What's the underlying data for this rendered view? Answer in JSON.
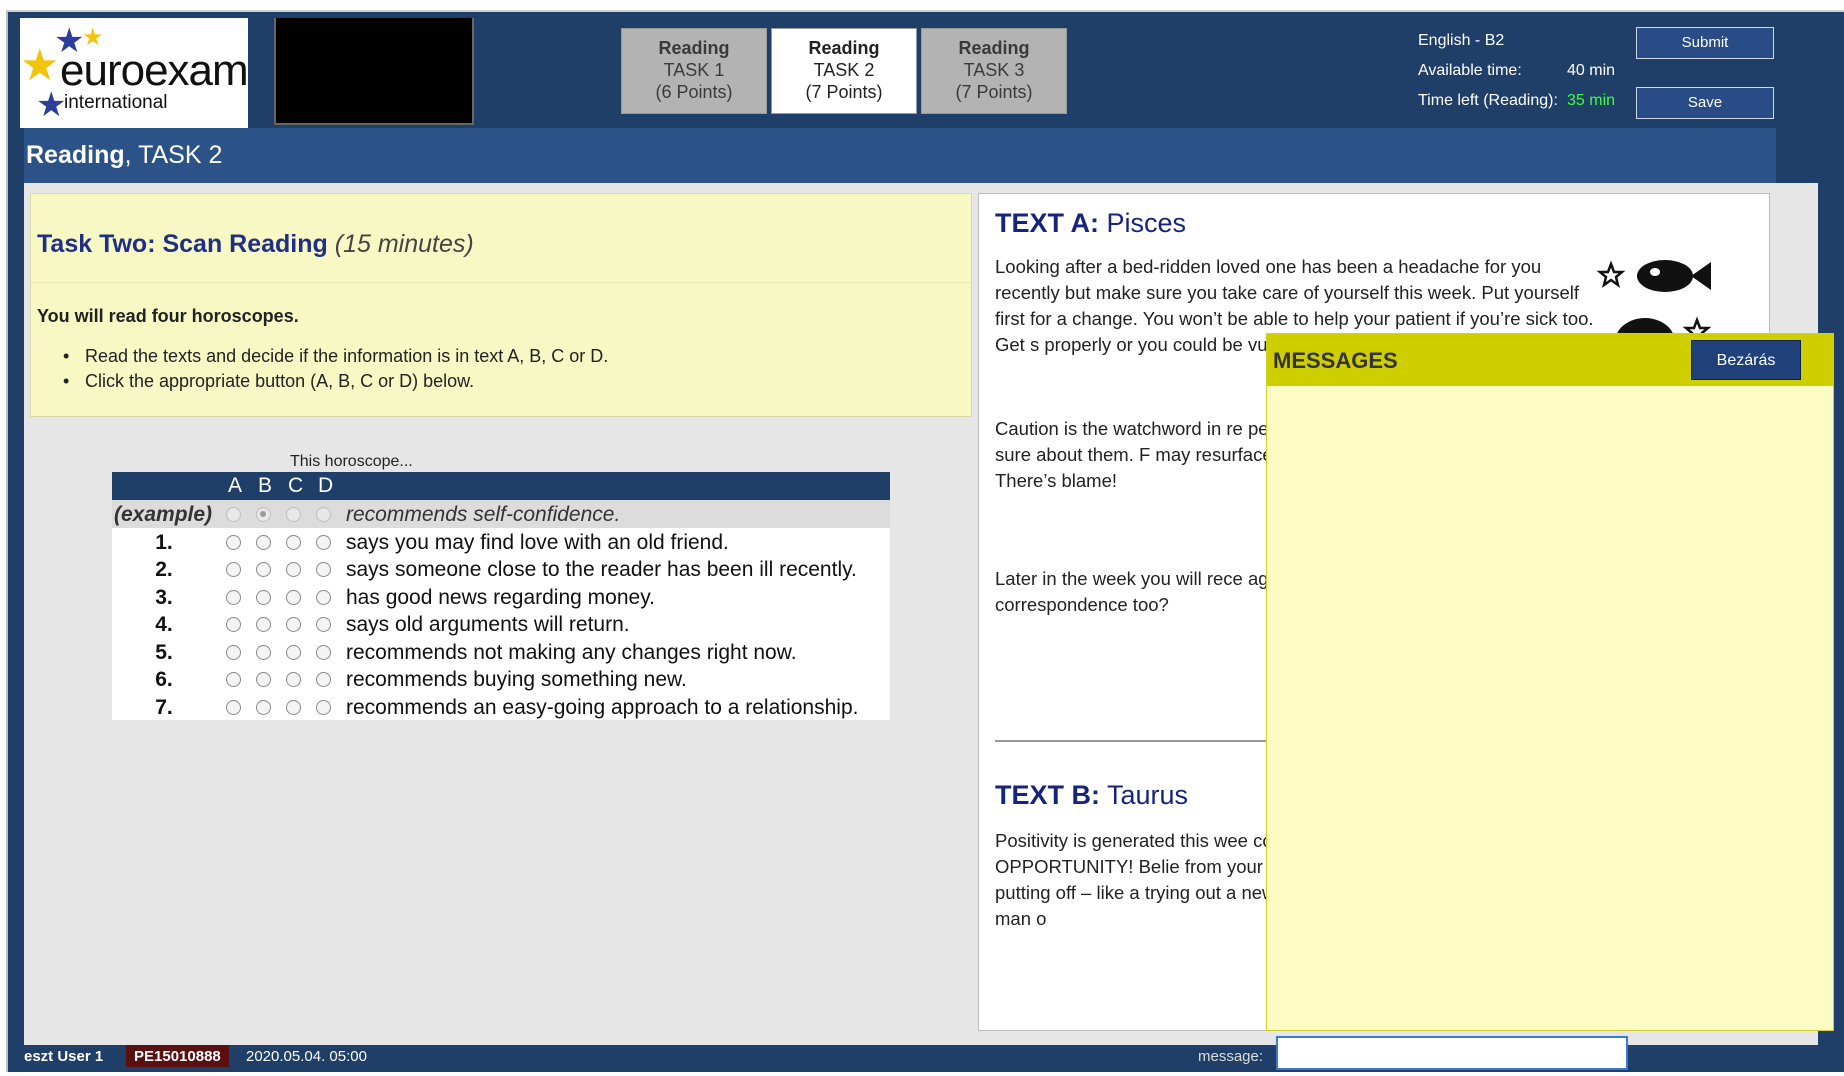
{
  "header": {
    "logo": {
      "name": "euroexam",
      "sub": "international"
    },
    "tabs": [
      {
        "line1": "Reading",
        "line2": "TASK 1",
        "line3": "(6 Points)",
        "active": false
      },
      {
        "line1": "Reading",
        "line2": "TASK 2",
        "line3": "(7 Points)",
        "active": true
      },
      {
        "line1": "Reading",
        "line2": "TASK 3",
        "line3": "(7 Points)",
        "active": false
      }
    ],
    "level": "English - B2",
    "available_label": "Available time:",
    "available_value": "40 min",
    "time_left_label": "Time left (Reading):",
    "time_left_value": "35 min",
    "submit_label": "Submit",
    "save_label": "Save"
  },
  "titlebar": {
    "bold": "Reading",
    "rest": ", TASK 2"
  },
  "task": {
    "title": "Task Two: Scan Reading",
    "duration": "(15 minutes)",
    "intro": "You will read four horoscopes.",
    "bullets": [
      "Read the texts and decide if the information is in text A, B, C or D.",
      "Click the appropriate button (A, B, C or D) below."
    ]
  },
  "questions": {
    "caption": "This horoscope...",
    "columns": [
      "A",
      "B",
      "C",
      "D"
    ],
    "example": {
      "num": "(example)",
      "text": "recommends self-confidence.",
      "selected": 1
    },
    "rows": [
      {
        "num": "1.",
        "text": "says you may find love with an old friend."
      },
      {
        "num": "2.",
        "text": "says someone close to the reader has been ill recently."
      },
      {
        "num": "3.",
        "text": "has good news regarding money."
      },
      {
        "num": "4.",
        "text": "says old arguments will return."
      },
      {
        "num": "5.",
        "text": "recommends not making any changes right now."
      },
      {
        "num": "6.",
        "text": "recommends buying something new."
      },
      {
        "num": "7.",
        "text": "recommends an easy-going approach to a relationship."
      }
    ]
  },
  "texts": {
    "a_label": "TEXT A:",
    "a_title": "Pisces",
    "a_para1": "Looking after a bed-ridden loved one has been a headache for you recently but make sure you take care of yourself this week. Put yourself first for a change. You won’t be able to help your patient if you’re sick too. Get s properly or you could be vulne work – so watch out!",
    "a_para2": "Caution is the watchword in re people often take advantage c until you’re sure about them. F may resurface this week. You try not to get involved. There’s blame!",
    "a_para3": "Later in the week you will rece ages. Don’t leave it too long b waiting correspondence too?",
    "b_label": "TEXT B:",
    "b_title": "Taurus",
    "b_para1": "Positivity is generated this wee contact with Mars. For a pessi means OPPORTUNITY! Belie from your stars by finally gettir you’ve been putting off – like a trying out a new recipe, getting weekend away with the man o"
  },
  "messages": {
    "title": "MESSAGES",
    "close_label": "Bezárás"
  },
  "footer": {
    "user": "eszt User 1",
    "code": "PE15010888",
    "datetime": "2020.05.04. 05:00",
    "message_label": "message:"
  }
}
